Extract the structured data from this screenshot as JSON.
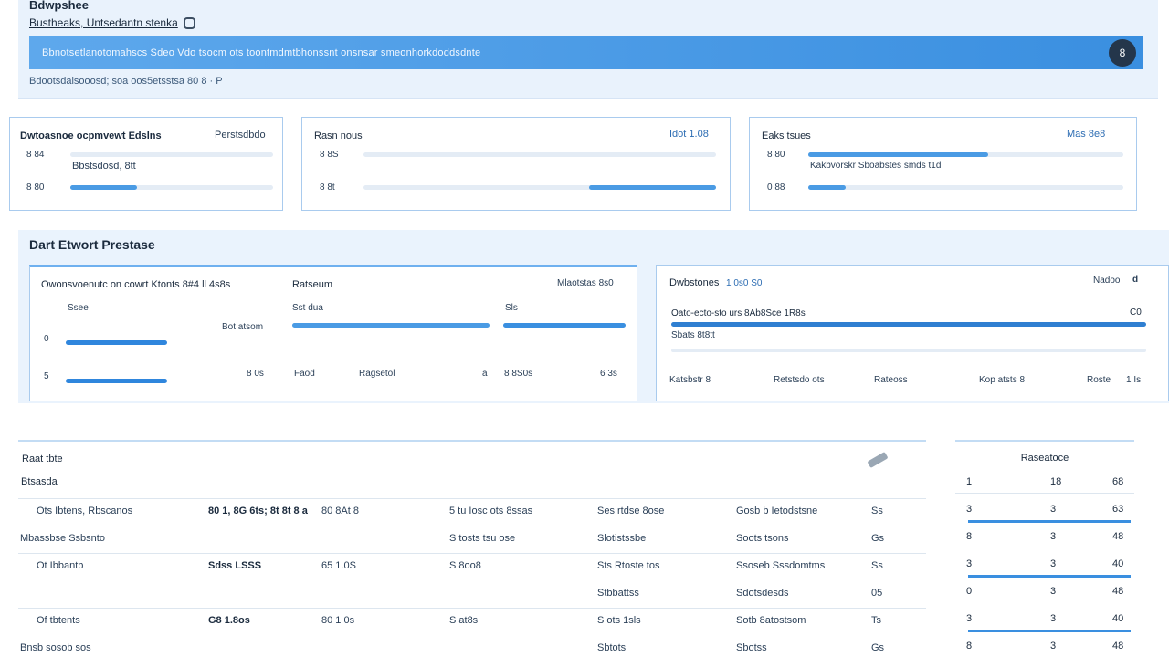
{
  "header": {
    "title": "Bdwpshee",
    "subtitle": "Bustheaks, Untsedantn stenka",
    "banner_text": "Bbnotsetlanotomahscs  Sdeo Vdo tsocm ots toontmdmtbhonssnt onsnsar smeonhorkdoddsdnte",
    "avatar_label": "8",
    "path": "Bdootsdalsooosd; soa oos5etsstsa  80 8 · P"
  },
  "stat_cards": [
    {
      "title": "Dwtoasnoe ocpmvewt Edslns",
      "meta": "Perstsdbdo",
      "rows": [
        {
          "label": "8 84",
          "fill": 0.0
        },
        {
          "label": "8 80",
          "fill": 0.33
        }
      ],
      "note": "Bbstsdosd, 8tt"
    },
    {
      "title": "Rasn nous",
      "meta": "Idot 1.08",
      "rows": [
        {
          "label": "8 8S",
          "fill": 0.0
        },
        {
          "label": "8 8t",
          "fill": 0.36
        }
      ]
    },
    {
      "title": "Eaks tsues",
      "meta": "Mas 8e8",
      "rows": [
        {
          "label": "8 80",
          "fill": 0.57
        },
        {
          "label": "0 88",
          "fill": 0.12
        }
      ],
      "note": "Kakbvorskr Sboabstes smds t1d"
    }
  ],
  "mid": {
    "title": "Dart Etwort Prestase",
    "left_panel": {
      "title": "Owonsvoenutc on cowrt Ktonts 8#4 ll 4s8s",
      "col2_title": "Ratseum",
      "meta": "Mlaotstas 8s0",
      "col1_head": "Ssee",
      "col2_head": "Sst dua",
      "col3_head": "Sls",
      "row1_label": "0",
      "row1_value": "Bot atsom",
      "row2_label": "5",
      "row2_value": "8 0s",
      "row2_col2a": "Faod",
      "row2_col2b": "Ragsetol",
      "row2_col2c": "a",
      "row2_col3a": "8 8S0s",
      "row2_col3b": "6 3s"
    },
    "right_panel": {
      "title": "Dwbstones",
      "title_meta": "1 0s0 S0",
      "meta": "Nadoo",
      "meta_icon": "d",
      "line1": "Oato-ecto-sto urs 8Ab8Sce 1R8s",
      "line1_value": "C0",
      "line2": "Sbats 8t8tt",
      "footer": [
        "Katsbstr 8",
        "Retstsdo ots",
        "Rateoss",
        "Kop atsts 8",
        "Roste",
        "1 Is"
      ]
    }
  },
  "table": {
    "title": "Raat tbte",
    "subtitle": "Btsasda",
    "rows": [
      [
        "Ots Ibtens, Rbscanos",
        "80 1, 8G 6ts; 8t 8t 8 a",
        "80 8At 8",
        "5 tu Iosc ots 8ssas",
        "Ses rtdse 8ose",
        "Gosb b Ietodstsne",
        "Ss"
      ],
      [
        "Mbassbse Ssbsnto",
        "",
        "",
        "S tosts tsu ose",
        "Slotistssbe",
        "Soots tsons",
        "Gs"
      ],
      [
        "Ot Ibbantb",
        "Sdss LSSS",
        "65 1.0S",
        "S 8oo8",
        "Sts Rtoste tos",
        "Ssoseb Sssdomtms",
        "Ss"
      ],
      [
        "",
        "",
        "",
        "",
        "Stbbattss",
        "Sdotsdesds",
        "05"
      ],
      [
        "Of tbtents",
        "G8 1.8os",
        "80 1 0s",
        "S at8s",
        "S ots 1sls",
        "Sotb 8atostsom",
        "Ts"
      ],
      [
        "Bnsb sosob sos",
        "",
        "",
        "",
        "Sbtots",
        "Sbotss",
        "Gs"
      ]
    ]
  },
  "side_table": {
    "title": "Raseatoce",
    "header": [
      "1",
      "18",
      "68"
    ],
    "rows": [
      [
        "3",
        "3",
        "63"
      ],
      [
        "8",
        "3",
        "48"
      ],
      [
        "3",
        "3",
        "40"
      ],
      [
        "0",
        "3",
        "48"
      ],
      [
        "3",
        "3",
        "40"
      ],
      [
        "8",
        "3",
        "48"
      ]
    ]
  },
  "icons": {
    "subtitle": "window-icon",
    "banner_avatar": "user-avatar",
    "table_action": "pencil-icon"
  },
  "colors": {
    "accent": "#3a8fe0",
    "header_bg": "#e9f2fc",
    "card_border": "#a9cbee"
  }
}
